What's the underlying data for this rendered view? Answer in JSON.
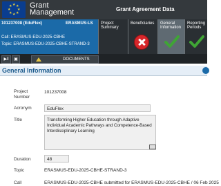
{
  "header": {
    "app_title": "Grant Management",
    "module_title": "Grant Agreement Data"
  },
  "context": {
    "project_id_acronym": "101237008 (EduFlex)",
    "programme": "ERASMUS-LS",
    "call": "Call: ERASMUS-EDU-2025-CBHE",
    "topic": "Topic: ERASMUS-EDU-2025-CBHE-STRAND-3"
  },
  "tabs": [
    {
      "label": "Project Summary",
      "status": "none",
      "status_icon": "",
      "active": false
    },
    {
      "label": "Beneficiaries",
      "status": "error",
      "status_icon": "error-x-icon",
      "active": false
    },
    {
      "label": "General Information",
      "status": "complete",
      "status_icon": "checkmark-icon",
      "active": true
    },
    {
      "label": "Reporting Periods",
      "status": "complete",
      "status_icon": "checkmark-icon",
      "active": false
    }
  ],
  "toolbar": {
    "documents_label": "DOCUMENTS"
  },
  "section": {
    "title": "General Information"
  },
  "form": {
    "project_number_label": "Project Number",
    "project_number": "101237008",
    "acronym_label": "Acronym",
    "acronym": "EduFlex",
    "title_label": "Title",
    "title": "Transforming Higher Education through Adaptive Individual Academic Pathways and Competence-Based Interdisciplinary Learning",
    "duration_label": "Duration",
    "duration": "48",
    "topic_label": "Topic",
    "topic": "ERASMUS-EDU-2025-CBHE-STRAND-3",
    "call_label": "Call",
    "call": "ERASMUS-EDU-2025-CBHE submitted for ERASMUS-EDU-2025-CBHE / 06 Feb 2025"
  },
  "colors": {
    "banner": "#34393d",
    "context_blue": "#1b6aa8",
    "tab_strip": "#2a2f33",
    "error_red": "#d7262a",
    "success_green": "#3fa535"
  }
}
